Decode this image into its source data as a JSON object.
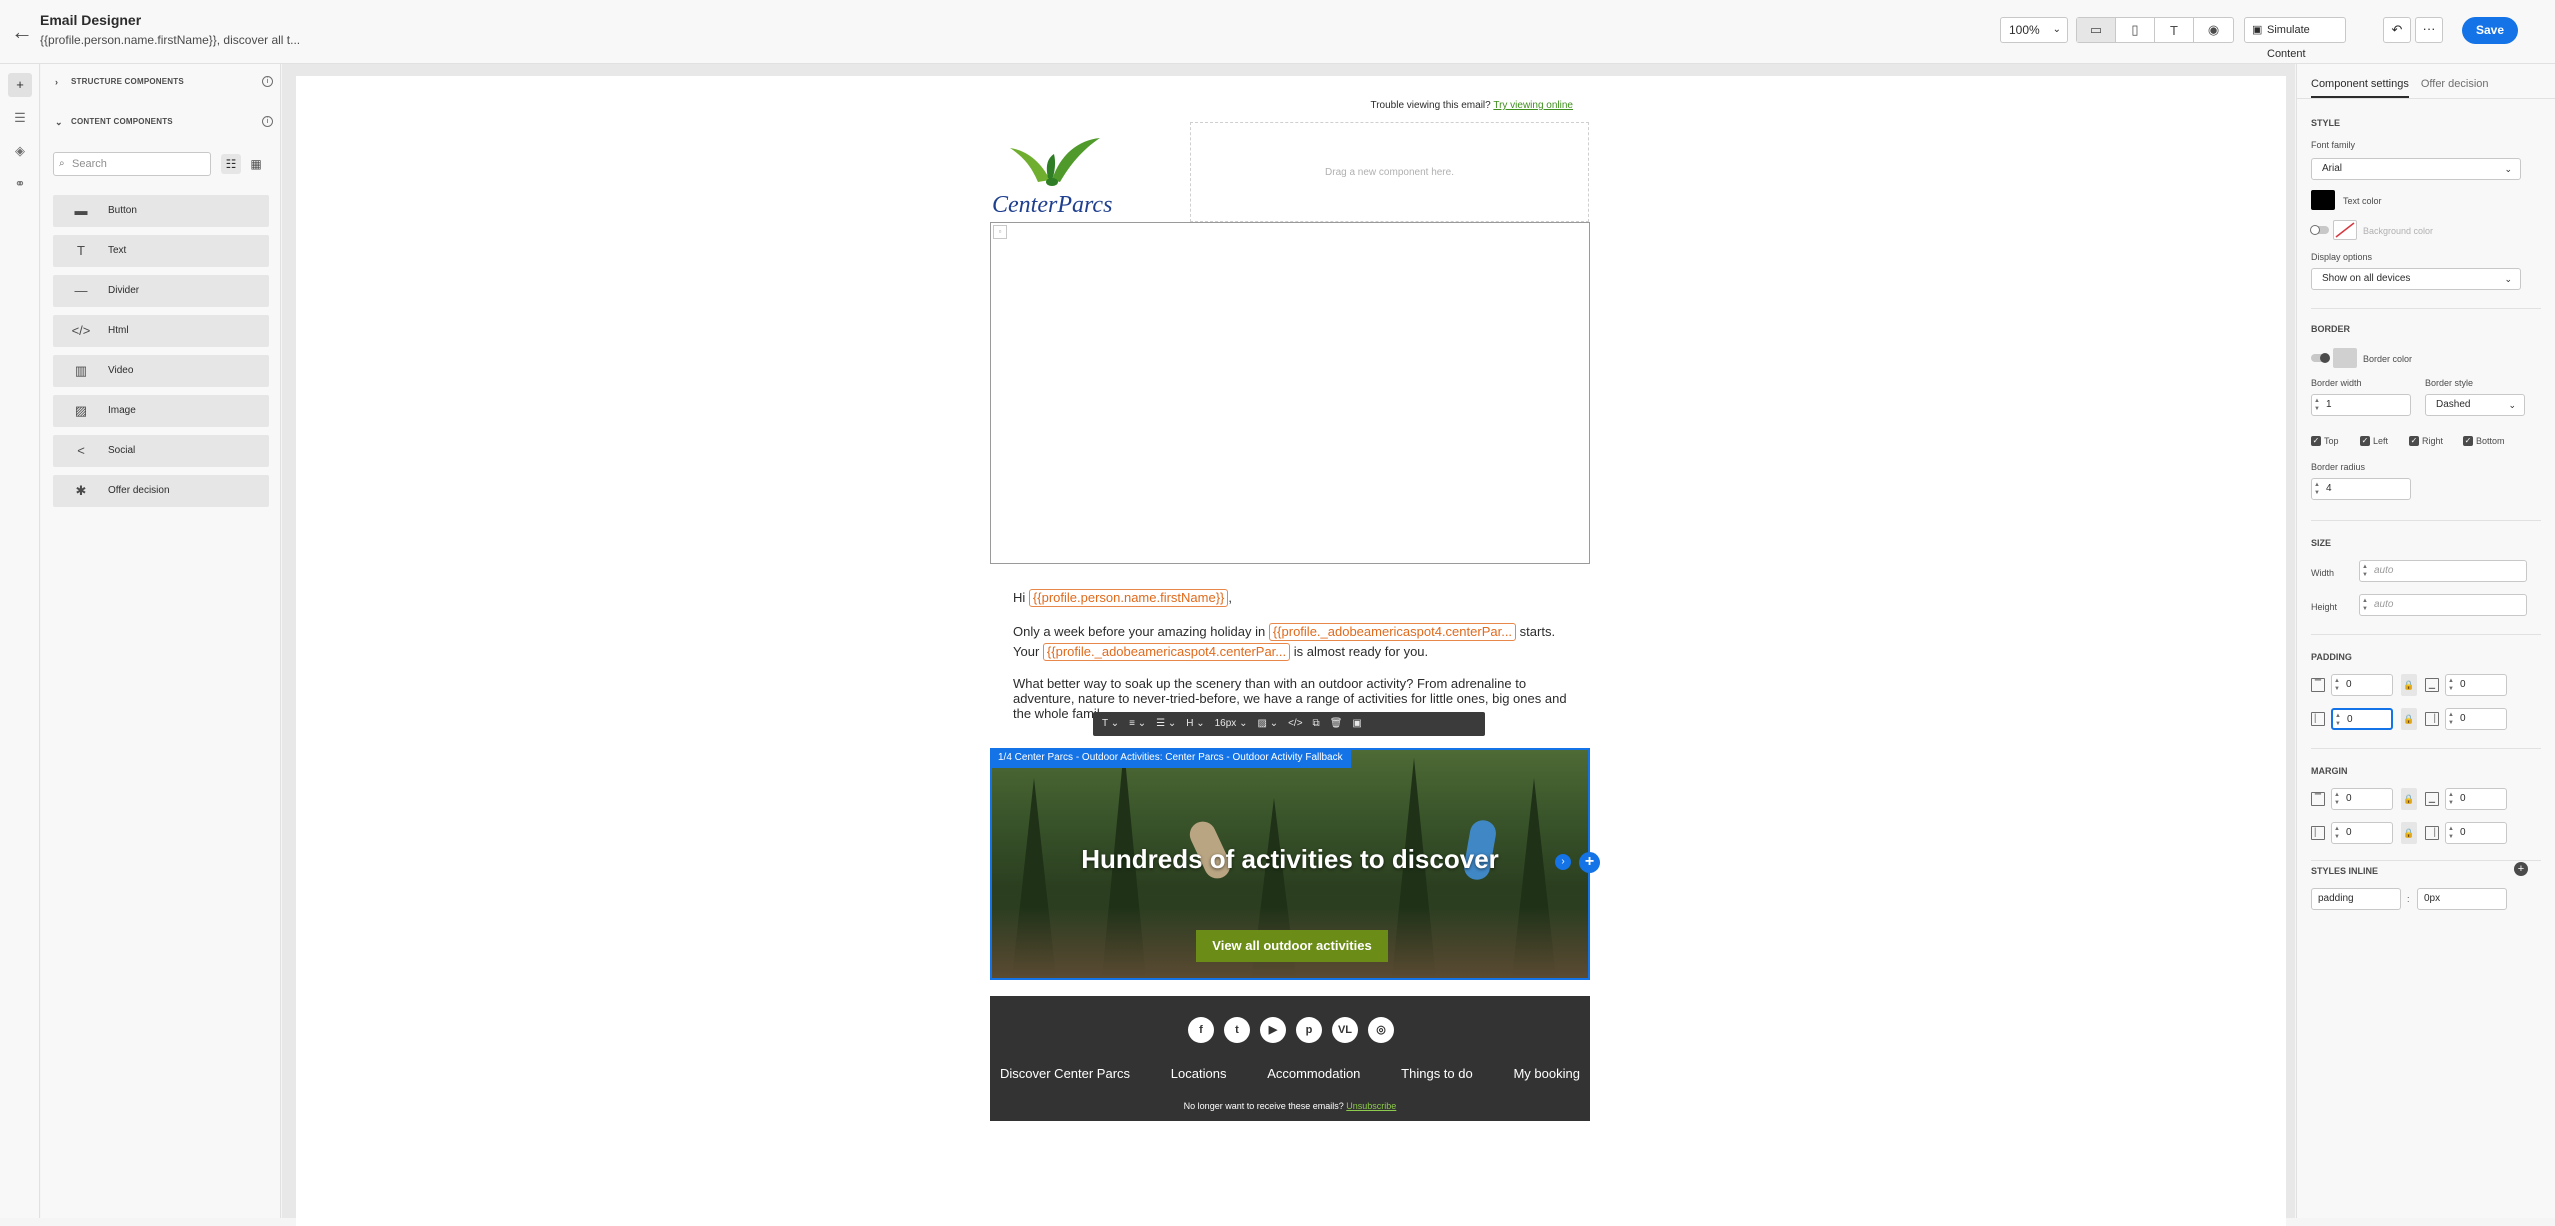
{
  "header": {
    "title": "Email Designer",
    "subtitle": "{{profile.person.name.firstName}}, discover all t...",
    "zoom": "100%",
    "simulate_label": "Simulate Content",
    "save_label": "Save"
  },
  "left": {
    "structure_label": "STRUCTURE COMPONENTS",
    "content_label": "CONTENT COMPONENTS",
    "search_placeholder": "Search",
    "components": [
      {
        "label": "Button",
        "icon": "button-icon"
      },
      {
        "label": "Text",
        "icon": "text-icon"
      },
      {
        "label": "Divider",
        "icon": "divider-icon"
      },
      {
        "label": "Html",
        "icon": "code-icon"
      },
      {
        "label": "Video",
        "icon": "video-icon"
      },
      {
        "label": "Image",
        "icon": "image-icon"
      },
      {
        "label": "Social",
        "icon": "share-icon"
      },
      {
        "label": "Offer decision",
        "icon": "offer-icon"
      }
    ]
  },
  "email": {
    "trouble_text": "Trouble viewing this email?",
    "trouble_link": "Try viewing online",
    "logo_text": "CenterParcs",
    "dropzone_text": "Drag a new component here.",
    "hi": "Hi",
    "first_name_tag": "{{profile.person.name.firstName}}",
    "comma": ",",
    "line2_a": "Only a week before your amazing holiday in",
    "center_tag": "{{profile._adobeamericaspot4.centerPar...",
    "line2_b": "starts.",
    "line3_a": "Your",
    "line3_b": "is almost ready for you.",
    "para1": "What better way to soak up the scenery than with an outdoor activity? From adrenaline to",
    "para2": "adventure, nature to never-tried-before, we have a range of activities for little ones, big ones and",
    "para3": "the whole famil",
    "banner_label": "1/4 Center Parcs - Outdoor Activities: Center Parcs - Outdoor Activity Fallback",
    "banner_heading": "Hundreds of activities to discover",
    "banner_button": "View all outdoor activities",
    "footer_nav": [
      "Discover Center Parcs",
      "Locations",
      "Accommodation",
      "Things to do",
      "My booking"
    ],
    "unsub_text": "No longer want to receive these emails?",
    "unsub_link": "Unsubscribe",
    "social": [
      "f",
      "t",
      "▶",
      "p",
      "VL",
      "◎"
    ]
  },
  "toolbar": {
    "font_size": "16px"
  },
  "right": {
    "tab_settings": "Component settings",
    "tab_offer": "Offer decision",
    "style_h": "STYLE",
    "font_family_label": "Font family",
    "font_family": "Arial",
    "text_color_label": "Text color",
    "bg_color_label": "Background color",
    "display_label": "Display options",
    "display_value": "Show on all devices",
    "border_h": "BORDER",
    "border_color_label": "Border color",
    "border_width_label": "Border width",
    "border_width": "1",
    "border_style_label": "Border style",
    "border_style": "Dashed",
    "sides": [
      "Top",
      "Left",
      "Right",
      "Bottom"
    ],
    "border_radius_label": "Border radius",
    "border_radius": "4",
    "size_h": "SIZE",
    "width_label": "Width",
    "width_placeholder": "auto",
    "height_label": "Height",
    "height_placeholder": "auto",
    "padding_h": "PADDING",
    "padding": [
      "0",
      "0",
      "0",
      "0"
    ],
    "margin_h": "MARGIN",
    "margin": [
      "0",
      "0",
      "0",
      "0"
    ],
    "styles_inline_h": "STYLES INLINE",
    "inline_prop": "padding",
    "inline_sep": ":",
    "inline_value": "0px"
  },
  "colors": {
    "accent": "#1473e6",
    "footer_bg": "#333333",
    "cta": "#6b8c17",
    "tag": "#e06a1c"
  }
}
